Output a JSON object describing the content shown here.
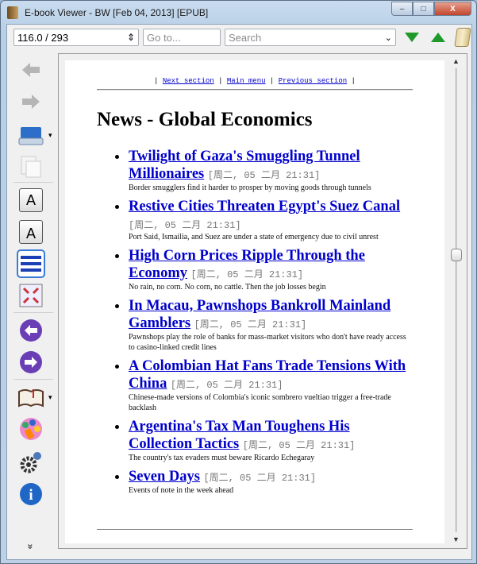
{
  "window": {
    "title": "E-book Viewer - BW [Feb 04, 2013] [EPUB]",
    "min": "–",
    "max": "□",
    "close": "X"
  },
  "toolbar": {
    "position": "116.0 / 293",
    "goto_placeholder": "Go to...",
    "search_placeholder": "Search",
    "spin": "⇕",
    "combo": "⌄"
  },
  "sidebar": {
    "more": "»",
    "dropdown": "▾"
  },
  "page": {
    "nav": {
      "sep": "|",
      "next": "Next section",
      "main": "Main menu",
      "prev": "Previous section"
    },
    "heading": "News - Global Economics",
    "articles": [
      {
        "title": "Twilight of Gaza's Smuggling Tunnel Millionaires",
        "date": "[周二, 05 二月 21:31]",
        "desc": "Border smugglers find it harder to prosper by moving goods through tunnels"
      },
      {
        "title": "Restive Cities Threaten Egypt's Suez Canal",
        "date": "[周二, 05 二月 21:31]",
        "desc": "Port Said, Ismailia, and Suez are under a state of emergency due to civil unrest"
      },
      {
        "title": "High Corn Prices Ripple Through the Economy",
        "date": "[周二, 05 二月 21:31]",
        "desc": "No rain, no corn. No corn, no cattle. Then the job losses begin"
      },
      {
        "title": "In Macau, Pawnshops Bankroll Mainland Gamblers",
        "date": "[周二, 05 二月 21:31]",
        "desc": "Pawnshops play the role of banks for mass-market visitors who don't have ready access to casino-linked credit lines"
      },
      {
        "title": "A Colombian Hat Fans Trade Tensions With China",
        "date": "[周二, 05 二月 21:31]",
        "desc": "Chinese-made versions of Colombia's iconic sombrero vueltiao trigger a free-trade backlash"
      },
      {
        "title": "Argentina's Tax Man Toughens His Collection Tactics",
        "date": "[周二, 05 二月 21:31]",
        "desc": "The country's tax evaders must beware Ricardo Echegaray"
      },
      {
        "title": "Seven Days",
        "date": "[周二, 05 二月 21:31]",
        "desc": "Events of note in the week ahead"
      }
    ]
  },
  "scroll": {
    "position_fraction": 0.4
  }
}
